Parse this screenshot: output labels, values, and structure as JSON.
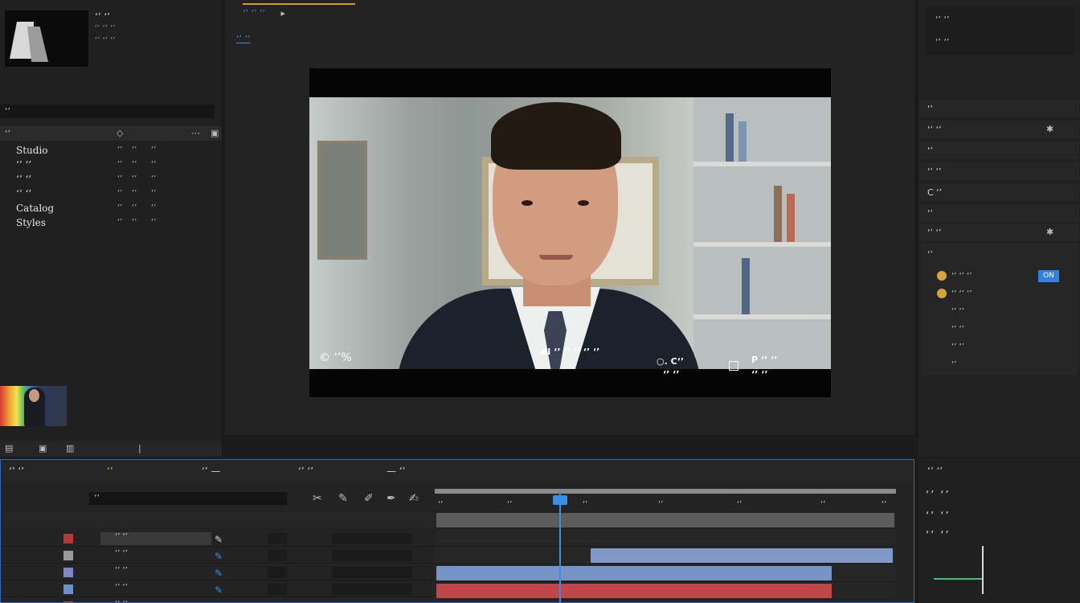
{
  "project": {
    "header_title": "‘’ ‘’",
    "clip_title": "‘’ ‘’",
    "clip_info": "‘’ ‘’ ‘’",
    "clip_info2": "‘’ ‘’ ‘’",
    "search_label": "‘’",
    "col_name": "‘’",
    "items": [
      {
        "name": "Studio",
        "c1": "‘’",
        "c2": "‘’",
        "c3": "‘’"
      },
      {
        "name": "‘’ ‘’",
        "c1": "‘’",
        "c2": "‘’",
        "c3": "‘’"
      },
      {
        "name": "‘’ ‘’",
        "c1": "‘’",
        "c2": "‘’",
        "c3": "‘’"
      },
      {
        "name": "‘’ ‘’",
        "c1": "‘’",
        "c2": "‘’",
        "c3": "‘’"
      },
      {
        "name": "Catalog",
        "c1": "‘’",
        "c2": "‘’",
        "c3": "‘’"
      },
      {
        "name": "Styles",
        "c1": "‘’",
        "c2": "‘’",
        "c3": "‘’"
      }
    ]
  },
  "viewer": {
    "tabs_label": "‘’ ‘’ ‘’",
    "comp_tab": "‘’ ‘’",
    "subtitle": "AI ‘’ ‘’ ‘’ ‘’ ‘’",
    "timecode": "© ‘’%",
    "overlay_left_top": "○. C‘’",
    "overlay_left_bottom": "‘’ ‘’",
    "overlay_right_top": "P ‘’ ‘’",
    "overlay_right_bottom": "‘’ ‘’",
    "toolbar": [
      "▣ ‘’",
      "‘’",
      "‘’",
      "‘’ ‘’",
      "‘’",
      "‘’",
      "‘’",
      "‘’ ‘’",
      "‘’",
      "‘’",
      "▶",
      "‘’",
      "‘’",
      "‘’"
    ]
  },
  "effects": {
    "top1": "‘’ ‘’",
    "top2": "‘’ ‘’",
    "rows": [
      "‘’",
      "‘’ ‘’",
      "‘’",
      "‘’ ‘’",
      "C ‘’",
      "‘’",
      "‘’ ‘’"
    ],
    "group_title": "‘’",
    "group_rows": [
      "‘’ ‘’ ‘’",
      "‘’ ‘’ ‘’",
      "‘’ ‘’",
      "‘’ ‘’",
      "‘’ ‘’",
      "‘’"
    ],
    "toggle": "ON"
  },
  "timeline": {
    "tabs": [
      "‘’ ‘’",
      "‘’",
      "‘’ —",
      "‘’ ‘’",
      "— ‘’"
    ],
    "search": "‘’",
    "ruler": [
      "‘’",
      "‘’",
      "‘’",
      "‘’",
      "‘’",
      "‘’",
      "‘’"
    ],
    "layers": [
      {
        "name": "‘’ ‘’",
        "color": "#b33a3a"
      },
      {
        "name": "‘’ ‘’",
        "color": "#9a9a9a"
      },
      {
        "name": "‘’ ‘’",
        "color": "#7c86c9"
      },
      {
        "name": "‘’ ‘’",
        "color": "#6a8fc6"
      },
      {
        "name": "‘’ ‘’",
        "color": "#c04040"
      }
    ]
  },
  "align": {
    "title": "‘’ ‘’",
    "row1": "‘’ ‘’",
    "row2": "‘’ ‘’",
    "row3": "‘’ ‘’"
  },
  "colors": {
    "accent": "#3a8ee6",
    "tab_active": "#d69a2a"
  }
}
